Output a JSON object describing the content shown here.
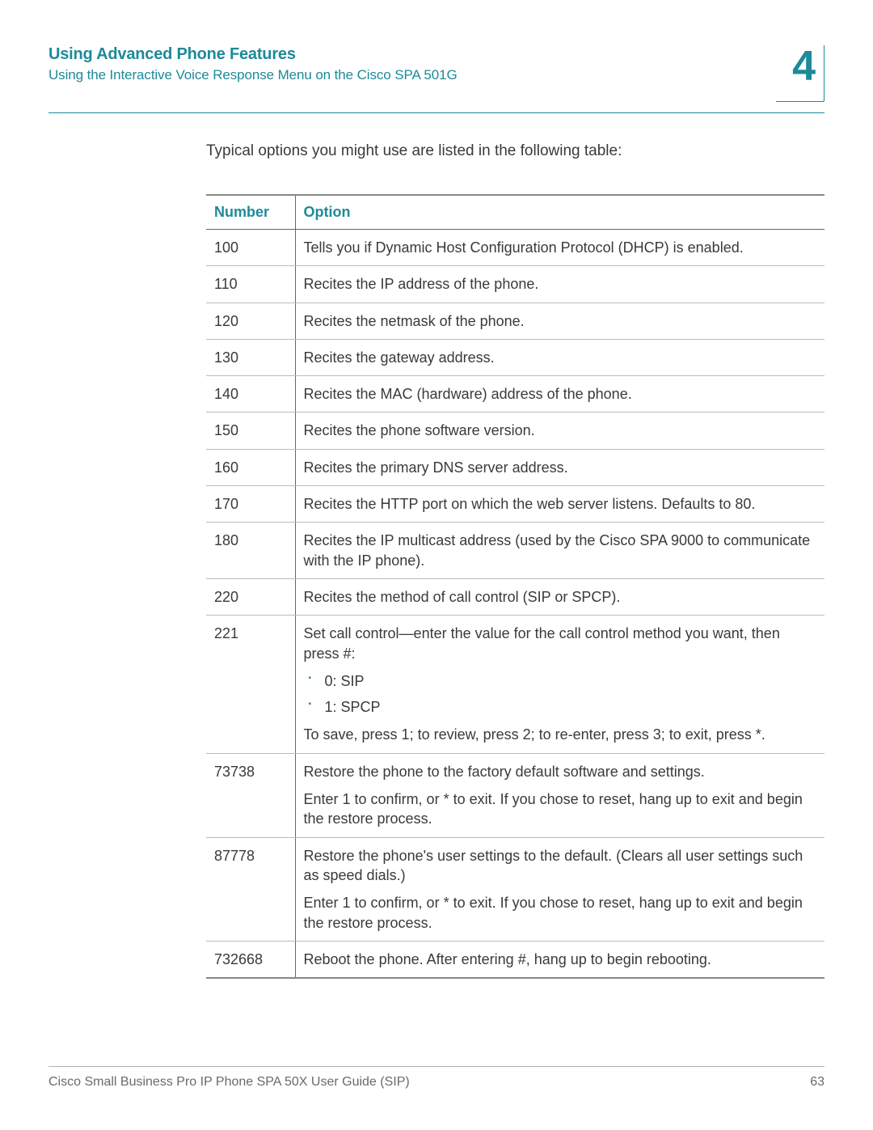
{
  "header": {
    "chapter_title": "Using Advanced Phone Features",
    "section_title": "Using the Interactive Voice Response Menu on the Cisco SPA 501G",
    "chapter_number": "4"
  },
  "intro": "Typical options you might use are listed in the following table:",
  "table": {
    "col_number": "Number",
    "col_option": "Option"
  },
  "rows": {
    "r0": {
      "num": "100",
      "opt": "Tells you if Dynamic Host Configuration Protocol (DHCP) is enabled."
    },
    "r1": {
      "num": "110",
      "opt": "Recites the IP address of the phone."
    },
    "r2": {
      "num": "120",
      "opt": "Recites the netmask of the phone."
    },
    "r3": {
      "num": "130",
      "opt": "Recites the gateway address."
    },
    "r4": {
      "num": "140",
      "opt": "Recites the MAC (hardware) address of the phone."
    },
    "r5": {
      "num": "150",
      "opt": "Recites the phone software version."
    },
    "r6": {
      "num": "160",
      "opt": "Recites the primary DNS server address."
    },
    "r7": {
      "num": "170",
      "opt": "Recites the HTTP port on which the web server listens. Defaults to 80."
    },
    "r8": {
      "num": "180",
      "opt": "Recites the IP multicast address (used by the Cisco SPA 9000 to communicate with the IP phone)."
    },
    "r9": {
      "num": "220",
      "opt": "Recites the method of call control (SIP or SPCP)."
    },
    "r10": {
      "num": "221",
      "p1": "Set call control—enter the value for the call control method you want, then press #:",
      "b0": "0: SIP",
      "b1": "1: SPCP",
      "p2": "To save, press 1; to review, press 2; to re-enter, press 3; to exit, press *."
    },
    "r11": {
      "num": "73738",
      "p1": "Restore the phone to the factory default software and settings.",
      "p2": "Enter 1 to confirm, or * to exit. If you chose to reset, hang up to exit and begin the restore process."
    },
    "r12": {
      "num": "87778",
      "p1": "Restore the phone's user settings to the default. (Clears all user settings such as speed dials.)",
      "p2": "Enter 1 to confirm, or * to exit. If you chose to reset, hang up to exit and begin the restore process."
    },
    "r13": {
      "num": "732668",
      "opt": "Reboot the phone. After entering #, hang up to begin rebooting."
    }
  },
  "footer": {
    "doc_title": "Cisco Small Business Pro IP Phone SPA 50X User Guide (SIP)",
    "page_number": "63"
  }
}
